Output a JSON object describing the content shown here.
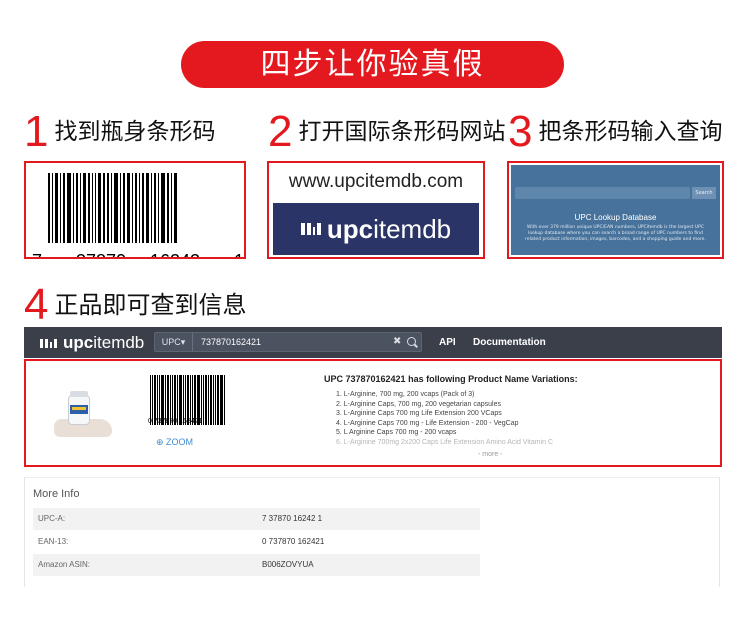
{
  "banner": "四步让你验真假",
  "steps": [
    {
      "num": "1",
      "text": "找到瓶身条形码"
    },
    {
      "num": "2",
      "text": "打开国际条形码网站"
    },
    {
      "num": "3",
      "text": "把条形码输入查询"
    },
    {
      "num": "4",
      "text": "正品即可查到信息"
    }
  ],
  "barcode_digits": [
    "7",
    "37870",
    "16242",
    "1"
  ],
  "site_url": "www.upcitemdb.com",
  "brand": {
    "prefix": "upc",
    "suffix": "itemdb"
  },
  "lookup_preview": {
    "button": "Search",
    "title": "UPC Lookup Database",
    "desc": "With over 379 million unique UPC/EAN numbers, UPCitemdb is the largest UPC lookup database where you can search a broad range of UPC numbers to find related product information, images, barcodes, and a shopping guide and more."
  },
  "navbar": {
    "search_type": "UPC▾",
    "query": "737870162421",
    "clear": "✖",
    "links": [
      "API",
      "Documentation"
    ]
  },
  "result": {
    "barcode_digits": "0  737870  162421",
    "zoom": "ZOOM",
    "title": "UPC 737870162421 has following Product Name Variations:",
    "items": [
      "1. L-Arginine, 700 mg, 200 vcaps (Pack of 3)",
      "2. L-Arginine Caps, 700 mg, 200 vegetarian capsules",
      "3. L-Arginine Caps 700 mg Life Extension 200 VCaps",
      "4. L-Arginine Caps 700 mg - Life Extension - 200 - VegCap",
      "5. L Arginine Caps 700 mg - 200 vcaps",
      "6. L-Arginine 700mg 2x200 Caps Life Extension Amino Acid Vitamin C"
    ],
    "more": "- more -"
  },
  "more_info": {
    "title": "More Info",
    "rows": [
      {
        "key": "UPC-A:",
        "value": "7 37870 16242 1"
      },
      {
        "key": "EAN-13:",
        "value": "0 737870 162421"
      },
      {
        "key": "Amazon ASIN:",
        "value": "B006ZOVYUA"
      }
    ]
  }
}
